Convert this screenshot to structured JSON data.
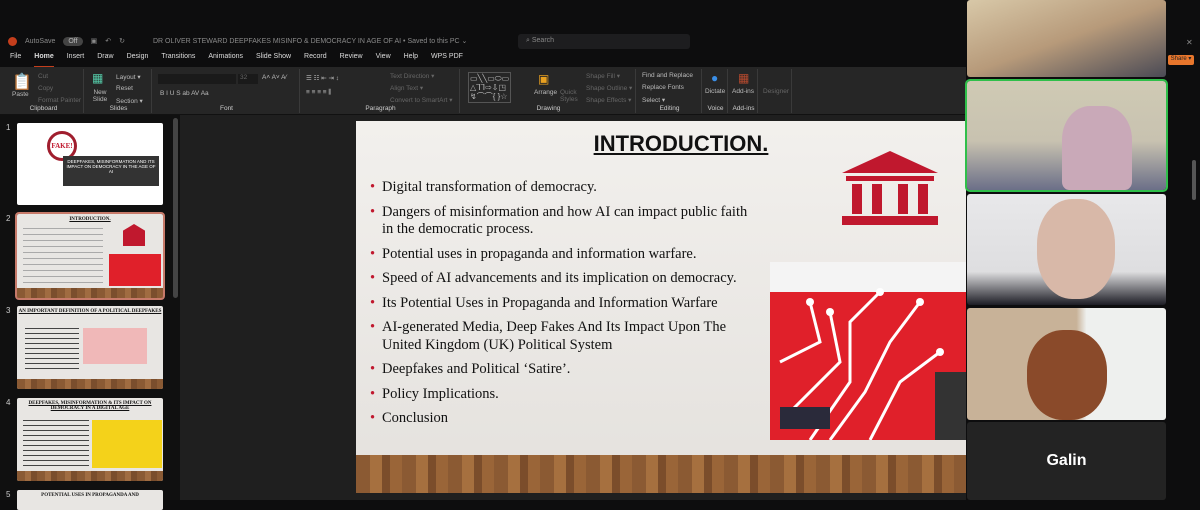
{
  "titlebar": {
    "autosave": "AutoSave",
    "toggle": "Off",
    "doc_title": "DR OLIVER STEWARD DEEPFAKES MISINFO & DEMOCRACY IN AGE OF AI • Saved to this PC ⌄",
    "search_placeholder": "Search"
  },
  "menu": [
    "File",
    "Home",
    "Insert",
    "Draw",
    "Design",
    "Transitions",
    "Animations",
    "Slide Show",
    "Record",
    "Review",
    "View",
    "Help",
    "WPS PDF"
  ],
  "ribbon": {
    "clipboard": {
      "label": "Clipboard",
      "paste": "Paste",
      "cut": "Cut",
      "copy": "Copy",
      "format_painter": "Format Painter"
    },
    "slides": {
      "label": "Slides",
      "new_slide": "New Slide",
      "layout": "Layout ▾",
      "reset": "Reset",
      "section": "Section ▾"
    },
    "font": {
      "label": "Font",
      "size": "32",
      "styles": "B  I  U  S  ab  AV  Aa"
    },
    "paragraph": {
      "label": "Paragraph",
      "text_direction": "Text Direction ▾",
      "align_text": "Align Text ▾",
      "smartart": "Convert to SmartArt ▾"
    },
    "drawing": {
      "label": "Drawing",
      "arrange": "Arrange",
      "quick_styles": "Quick Styles",
      "shape_fill": "Shape Fill ▾",
      "shape_outline": "Shape Outline ▾",
      "shape_effects": "Shape Effects ▾"
    },
    "editing": {
      "label": "Editing",
      "find": "Find and Replace",
      "replace_fonts": "Replace Fonts",
      "select": "Select ▾"
    },
    "voice": {
      "label": "Voice",
      "dictate": "Dictate"
    },
    "addins": {
      "label": "Add-ins",
      "addins": "Add-ins"
    },
    "designer": "Designer"
  },
  "thumbnails": [
    {
      "num": "1",
      "title": "DEEPFAKES, MISINFORMATION AND ITS IMPACT ON DEMOCRACY IN THE AGE OF AI",
      "badge": "FAKE!"
    },
    {
      "num": "2",
      "title": "INTRODUCTION."
    },
    {
      "num": "3",
      "title": "AN IMPORTANT DEFINITION OF A POLITICAL DEEPFAKES"
    },
    {
      "num": "4",
      "title": "DEEPFAKES, MISINFORMATION & ITS IMPACT ON DEMOCRACY IN A DIGITAL AGE"
    },
    {
      "num": "5",
      "title": "POTENTIAL USES IN PROPAGANDA AND"
    }
  ],
  "slide": {
    "title": "INTRODUCTION.",
    "bullets": [
      "Digital transformation of democracy.",
      "Dangers of misinformation and how AI can impact public faith in the democratic process.",
      "Potential uses in propaganda and information warfare.",
      "Speed of AI advancements and its implication on democracy.",
      "Its Potential Uses in Propaganda and Information Warfare",
      "AI-generated Media, Deep Fakes And Its Impact Upon The United Kingdom (UK) Political System",
      "Deepfakes and Political ‘Satire’.",
      "Policy Implications.",
      "Conclusion"
    ],
    "accent": "#c0182e"
  },
  "video": {
    "share": "Share ▾",
    "participant_name": "Galin",
    "speaker_border": "#2fbf4a"
  }
}
